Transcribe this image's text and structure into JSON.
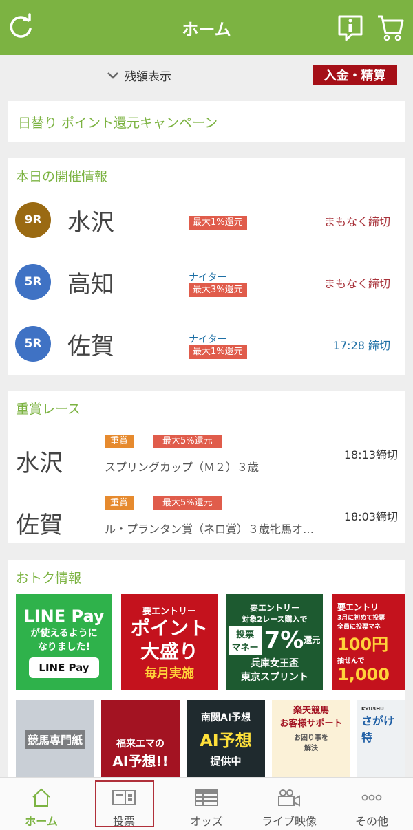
{
  "header": {
    "title": "ホーム",
    "left_icon": "refresh-icon",
    "info_icon": "info-icon",
    "cart_icon": "cart-icon"
  },
  "balance": {
    "toggle_label": "残額表示",
    "deposit_label": "入金・精算"
  },
  "campaign": {
    "label": "日替り ポイント還元キャンペーン"
  },
  "today": {
    "title": "本日の開催情報",
    "races": [
      {
        "race": "9R",
        "badge_color": "#9a6a12",
        "venue": "水沢",
        "nighter": "",
        "reward": "最大1%還元",
        "status": "まもなく締切",
        "status_color": "#a8323a"
      },
      {
        "race": "5R",
        "badge_color": "#3f72c4",
        "venue": "高知",
        "nighter": "ナイター",
        "reward": "最大3%還元",
        "status": "まもなく締切",
        "status_color": "#a8323a"
      },
      {
        "race": "5R",
        "badge_color": "#3f72c4",
        "venue": "佐賀",
        "nighter": "ナイター",
        "reward": "最大1%還元",
        "status": "17:28 締切",
        "status_color": "#1d6fa5"
      }
    ]
  },
  "grade": {
    "title": "重賞レース",
    "races": [
      {
        "venue": "水沢",
        "tag": "重賞",
        "reward": "最大5%還元",
        "name": "スプリングカップ（Ｍ２）３歳",
        "time": "18:13締切"
      },
      {
        "venue": "佐賀",
        "tag": "重賞",
        "reward": "最大5%還元",
        "name": "ル・プランタン賞（ネロ賞）３歳牝馬オ…",
        "time": "18:03締切"
      }
    ]
  },
  "deals": {
    "title": "おトク情報",
    "banner1": {
      "l1": "LINE Pay",
      "l2": "が使えるように",
      "l3": "なりました!",
      "l4": "LINE Pay"
    },
    "banner2": {
      "l1": "要エントリー",
      "l2": "ポイント",
      "l3": "大盛り",
      "l4": "毎月実施"
    },
    "banner3": {
      "l1": "要エントリー",
      "l2": "対象2レース購入で",
      "l3": "投票",
      "l4": "マネー",
      "l5": "7%",
      "l6": "還元",
      "l7": "兵庫女王盃",
      "l8": "東京スプリント"
    },
    "banner4": {
      "l1": "要エントリ",
      "l2": "3月に初めて投票",
      "l3": "全員に投票マネ",
      "l4": "100円",
      "l5": "抽せんで",
      "l6": "1,000"
    },
    "banner5": {
      "l1": "競馬専門紙"
    },
    "banner6": {
      "l1": "福来エマの",
      "l2": "AI予想!!"
    },
    "banner7": {
      "l1": "南関AI予想",
      "l2": "AI予想",
      "l3": "提供中"
    },
    "banner8": {
      "l1": "楽天競馬",
      "l2": "お客様サポート",
      "l3": "お困り事を",
      "l4": "解決"
    },
    "banner9": {
      "l1": "KYUSHU",
      "l2": "さがけ",
      "l3": "特"
    }
  },
  "tabs": [
    {
      "label": "ホーム",
      "icon": "home-icon"
    },
    {
      "label": "投票",
      "icon": "ticket-icon"
    },
    {
      "label": "オッズ",
      "icon": "odds-table-icon"
    },
    {
      "label": "ライブ映像",
      "icon": "video-camera-icon"
    },
    {
      "label": "その他",
      "icon": "more-dots-icon"
    }
  ]
}
